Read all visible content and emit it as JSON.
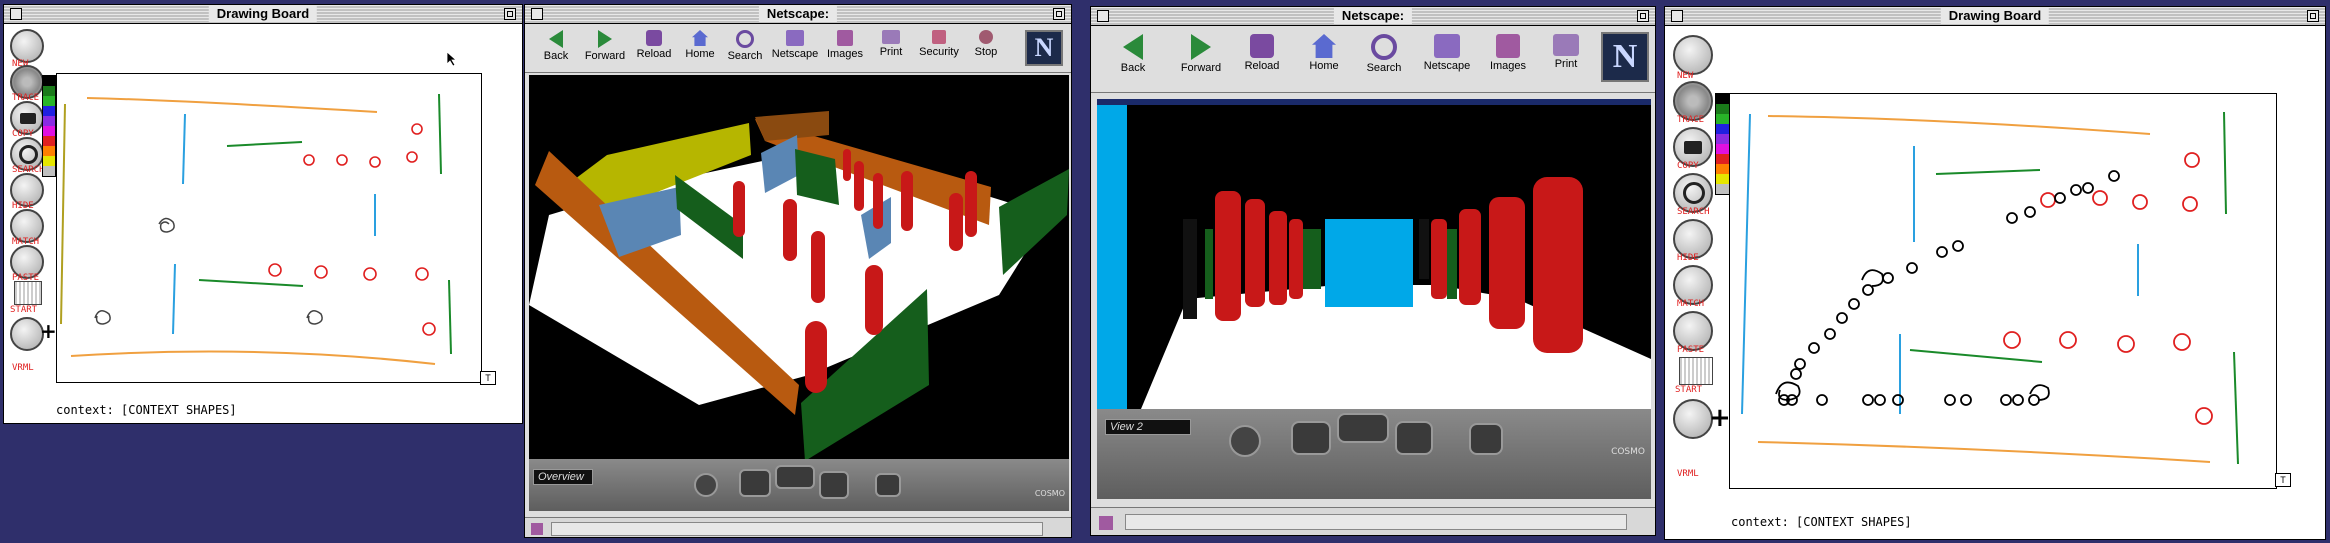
{
  "windows": {
    "drawing_left": {
      "title": "Drawing Board",
      "context_text": "context: [CONTEXT SHAPES]",
      "corner_box": "T"
    },
    "netscape_left": {
      "title": "Netscape:",
      "viewpoint_label": "Overview"
    },
    "netscape_right": {
      "title": "Netscape:",
      "viewpoint_label": "View 2"
    },
    "drawing_right": {
      "title": "Drawing Board",
      "context_text": "context: [CONTEXT SHAPES]",
      "corner_box": "T"
    }
  },
  "drawing_tools": [
    {
      "label": "NEW",
      "icon": "blank-circle-icon"
    },
    {
      "label": "TRACE",
      "icon": "gear-icon"
    },
    {
      "label": "COPY",
      "icon": "camera-icon"
    },
    {
      "label": "SEARCH",
      "icon": "magnifier-icon"
    },
    {
      "label": "HIDE",
      "icon": "blank-circle-icon"
    },
    {
      "label": "MATCH",
      "icon": "match-icon"
    },
    {
      "label": "PASTE",
      "icon": "hand-icon"
    },
    {
      "label": "START",
      "icon": "grid-icon"
    },
    {
      "label": "VRML",
      "icon": "vrml-icon"
    }
  ],
  "palette_colors": [
    "#000000",
    "#1a7a1a",
    "#28b428",
    "#2020e0",
    "#8a2be2",
    "#e010e0",
    "#e02020",
    "#ff8000",
    "#e6e600",
    "#c0c0c0"
  ],
  "netscape_left_toolbar": [
    {
      "label": "Back",
      "icon": "back-arrow-icon"
    },
    {
      "label": "Forward",
      "icon": "forward-arrow-icon"
    },
    {
      "label": "Reload",
      "icon": "reload-icon"
    },
    {
      "label": "Home",
      "icon": "home-icon"
    },
    {
      "label": "Search",
      "icon": "search-icon"
    },
    {
      "label": "Netscape",
      "icon": "netscape-icon"
    },
    {
      "label": "Images",
      "icon": "images-icon"
    },
    {
      "label": "Print",
      "icon": "print-icon"
    },
    {
      "label": "Security",
      "icon": "lock-icon"
    },
    {
      "label": "Stop",
      "icon": "stop-icon"
    }
  ],
  "netscape_right_toolbar": [
    {
      "label": "Back",
      "icon": "back-arrow-icon"
    },
    {
      "label": "Forward",
      "icon": "forward-arrow-icon"
    },
    {
      "label": "Reload",
      "icon": "reload-icon"
    },
    {
      "label": "Home",
      "icon": "home-icon"
    },
    {
      "label": "Search",
      "icon": "search-icon"
    },
    {
      "label": "Netscape",
      "icon": "netscape-icon"
    },
    {
      "label": "Images",
      "icon": "images-icon"
    },
    {
      "label": "Print",
      "icon": "print-icon"
    }
  ],
  "netscape_logo": "N",
  "cosmo_label": "COSMO",
  "colors": {
    "desktop": "#2f2f6b",
    "window_bg": "#ffffff",
    "stroke_red": "#e02020",
    "stroke_orange": "#f0a040",
    "stroke_green": "#1a8a2a",
    "stroke_blue": "#2aa0e0",
    "wall_orange": "#b85a10",
    "wall_yellow": "#b6b600",
    "wall_green": "#155e1c",
    "wall_blue": "#5a86b4",
    "pillar_red": "#c81818",
    "cyan_panel": "#00a8e8"
  }
}
